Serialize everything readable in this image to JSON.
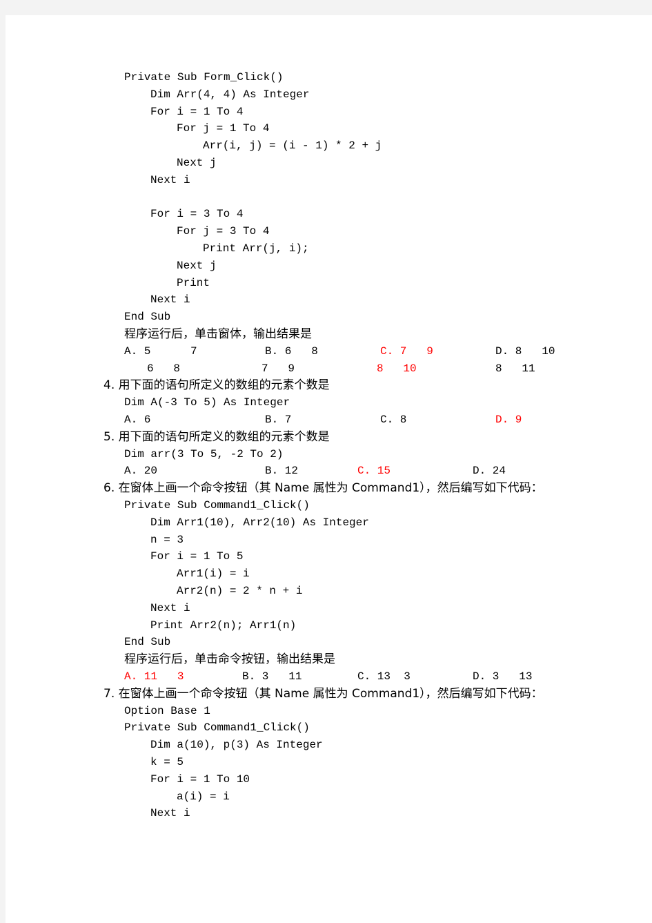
{
  "document": {
    "q3": {
      "code": [
        {
          "indent": 0,
          "text": "Private Sub Form_Click()"
        },
        {
          "indent": 1,
          "text": "Dim Arr(4, 4) As Integer"
        },
        {
          "indent": 1,
          "text": "For i = 1 To 4"
        },
        {
          "indent": 2,
          "text": "For j = 1 To 4"
        },
        {
          "indent": 3,
          "text": "Arr(i, j) = (i - 1) * 2 + j"
        },
        {
          "indent": 2,
          "text": "Next j"
        },
        {
          "indent": 1,
          "text": "Next i"
        },
        {
          "indent": 0,
          "text": ""
        },
        {
          "indent": 1,
          "text": "For i = 3 To 4"
        },
        {
          "indent": 2,
          "text": "For j = 3 To 4"
        },
        {
          "indent": 3,
          "text": "Print Arr(j, i);"
        },
        {
          "indent": 2,
          "text": "Next j"
        },
        {
          "indent": 2,
          "text": "Print"
        },
        {
          "indent": 1,
          "text": "Next i"
        },
        {
          "indent": 0,
          "text": "End Sub"
        }
      ],
      "prompt": "程序运行后，单击窗体，输出结果是",
      "options_row1": [
        "A. 5      7",
        "B. 6   8",
        "C. 7   9",
        "D. 8   10"
      ],
      "options_row2": [
        "6   8",
        "7   9",
        "8   10",
        "8   11"
      ],
      "correct": "C"
    },
    "q4": {
      "title": "4. 用下面的语句所定义的数组的元素个数是",
      "code": "Dim A(-3 To 5) As Integer",
      "options": [
        "A. 6",
        "B. 7",
        "C. 8",
        "D. 9"
      ],
      "correct": "D"
    },
    "q5": {
      "title": "5. 用下面的语句所定义的数组的元素个数是",
      "code": "Dim arr(3 To 5, -2 To 2)",
      "options": [
        "A. 20",
        "B. 12",
        "C. 15",
        "D. 24"
      ],
      "correct": "C"
    },
    "q6": {
      "title": "6. 在窗体上画一个命令按钮（其 Name 属性为 Command1），然后编写如下代码：",
      "code": [
        {
          "indent": 0,
          "text": "Private Sub Command1_Click()"
        },
        {
          "indent": 1,
          "text": "Dim Arr1(10), Arr2(10) As Integer"
        },
        {
          "indent": 1,
          "text": "n = 3"
        },
        {
          "indent": 1,
          "text": "For i = 1 To 5"
        },
        {
          "indent": 2,
          "text": "Arr1(i) = i"
        },
        {
          "indent": 2,
          "text": "Arr2(n) = 2 * n + i"
        },
        {
          "indent": 1,
          "text": "Next i"
        },
        {
          "indent": 1,
          "text": "Print Arr2(n); Arr1(n)"
        },
        {
          "indent": 0,
          "text": "End Sub"
        }
      ],
      "prompt": "程序运行后，单击命令按钮，输出结果是",
      "options": [
        "A. 11   3",
        "B. 3   11",
        "C. 13  3",
        "D. 3   13"
      ],
      "correct": "A"
    },
    "q7": {
      "title": "7. 在窗体上画一个命令按钮（其 Name 属性为 Command1），然后编写如下代码：",
      "code": [
        {
          "indent": 0,
          "text": "Option Base 1"
        },
        {
          "indent": 0,
          "text": "Private Sub Command1_Click()"
        },
        {
          "indent": 1,
          "text": "Dim a(10), p(3) As Integer"
        },
        {
          "indent": 1,
          "text": "k = 5"
        },
        {
          "indent": 1,
          "text": "For i = 1 To 10"
        },
        {
          "indent": 2,
          "text": "a(i) = i"
        },
        {
          "indent": 1,
          "text": "Next i"
        }
      ]
    }
  },
  "colors": {
    "answer": "#ff0000",
    "text": "#000000",
    "background": "#f3f3f3",
    "page": "#ffffff"
  }
}
